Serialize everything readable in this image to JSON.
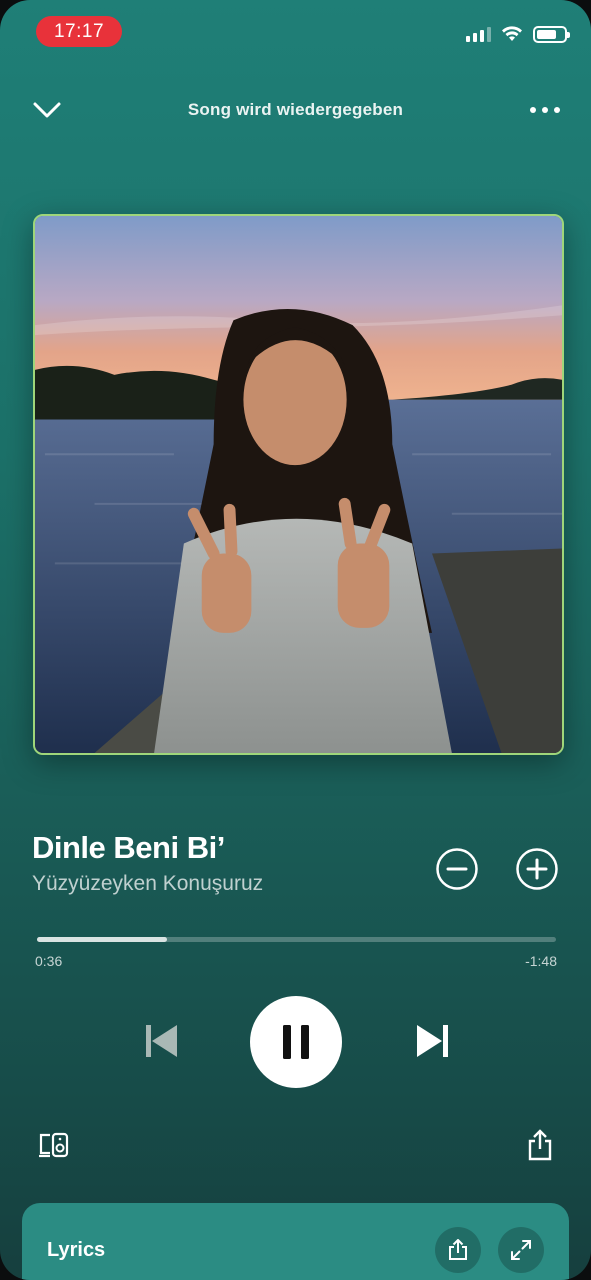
{
  "status_bar": {
    "time": "17:17",
    "time_pill_color": "#e8323a",
    "icons": [
      "signal-icon",
      "wifi-icon",
      "battery-icon"
    ]
  },
  "header": {
    "title": "Song wird wiedergegeben",
    "left_icon": "chevron-down-icon",
    "right_icon": "more-dots-icon"
  },
  "track": {
    "title": "Dinle Beni Bi’",
    "artist": "Yüzyüzeyken Konuşuruz"
  },
  "progress": {
    "elapsed": "0:36",
    "remaining": "-1:48",
    "fraction": 0.25
  },
  "controls": {
    "icons": [
      "skip-previous-icon",
      "pause-icon",
      "skip-next-icon"
    ],
    "state": "playing"
  },
  "lyrics": {
    "label": "Lyrics",
    "icons": [
      "share-icon",
      "expand-icon"
    ]
  },
  "colors": {
    "background_top": "#1f7f77",
    "background_bottom": "#163f3e",
    "lyrics_card": "#2b8c83",
    "artwork_border": "#9fd67a"
  }
}
